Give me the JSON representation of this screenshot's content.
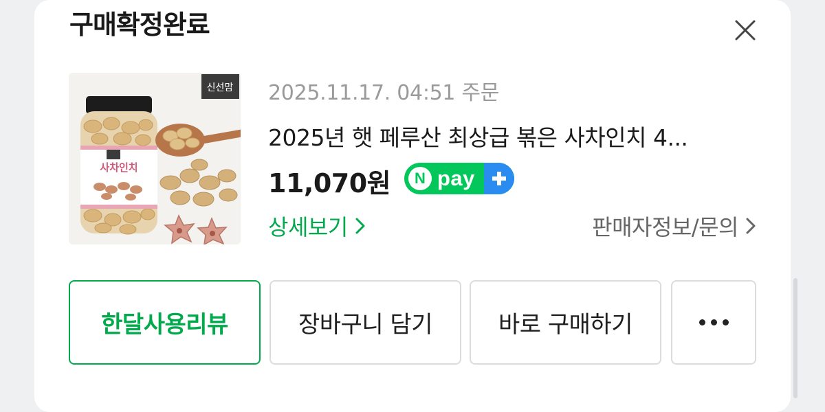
{
  "header": {
    "title": "구매확정완료"
  },
  "order": {
    "date_label": "2025.11.17. 04:51 주문",
    "product_name": "2025년 햇 페루산 최상급 볶은 사차인치 4...",
    "price": "11,070원",
    "thumbnail": {
      "brand_logo_text": "신선맘",
      "jar_label": "사차인치"
    },
    "payment_badge": {
      "n_letter": "N",
      "text": "pay",
      "plus_icon": "plus-icon",
      "color": "#03c75a",
      "plus_color": "#2a8cf0"
    }
  },
  "links": {
    "detail": "상세보기",
    "seller": "판매자정보/문의"
  },
  "actions": {
    "review": "한달사용리뷰",
    "cart": "장바구니 담기",
    "buy": "바로 구매하기",
    "more_icon": "more-dots-icon"
  },
  "colors": {
    "accent_green": "#03a94d",
    "border": "#dcdcdc"
  }
}
